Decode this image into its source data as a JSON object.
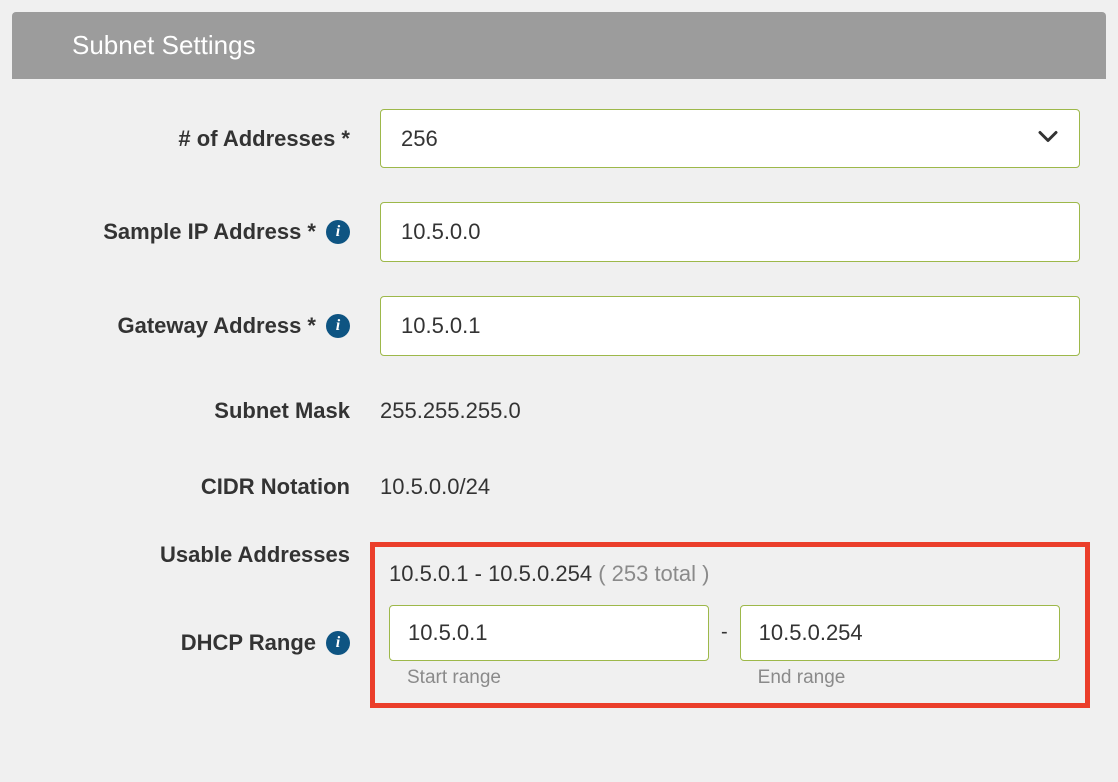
{
  "header": {
    "title": "Subnet Settings"
  },
  "fields": {
    "addresses": {
      "label": "# of Addresses *",
      "value": "256"
    },
    "sample_ip": {
      "label": "Sample IP Address *",
      "value": "10.5.0.0"
    },
    "gateway": {
      "label": "Gateway Address *",
      "value": "10.5.0.1"
    },
    "mask": {
      "label": "Subnet Mask",
      "value": "255.255.255.0"
    },
    "cidr": {
      "label": "CIDR Notation",
      "value": "10.5.0.0/24"
    },
    "usable": {
      "label": "Usable Addresses",
      "range": "10.5.0.1 - 10.5.0.254",
      "total": "( 253 total )"
    },
    "dhcp": {
      "label": "DHCP Range",
      "start": {
        "value": "10.5.0.1",
        "caption": "Start range"
      },
      "end": {
        "value": "10.5.0.254",
        "caption": "End range"
      },
      "dash": "-"
    }
  },
  "icons": {
    "info_glyph": "i"
  }
}
